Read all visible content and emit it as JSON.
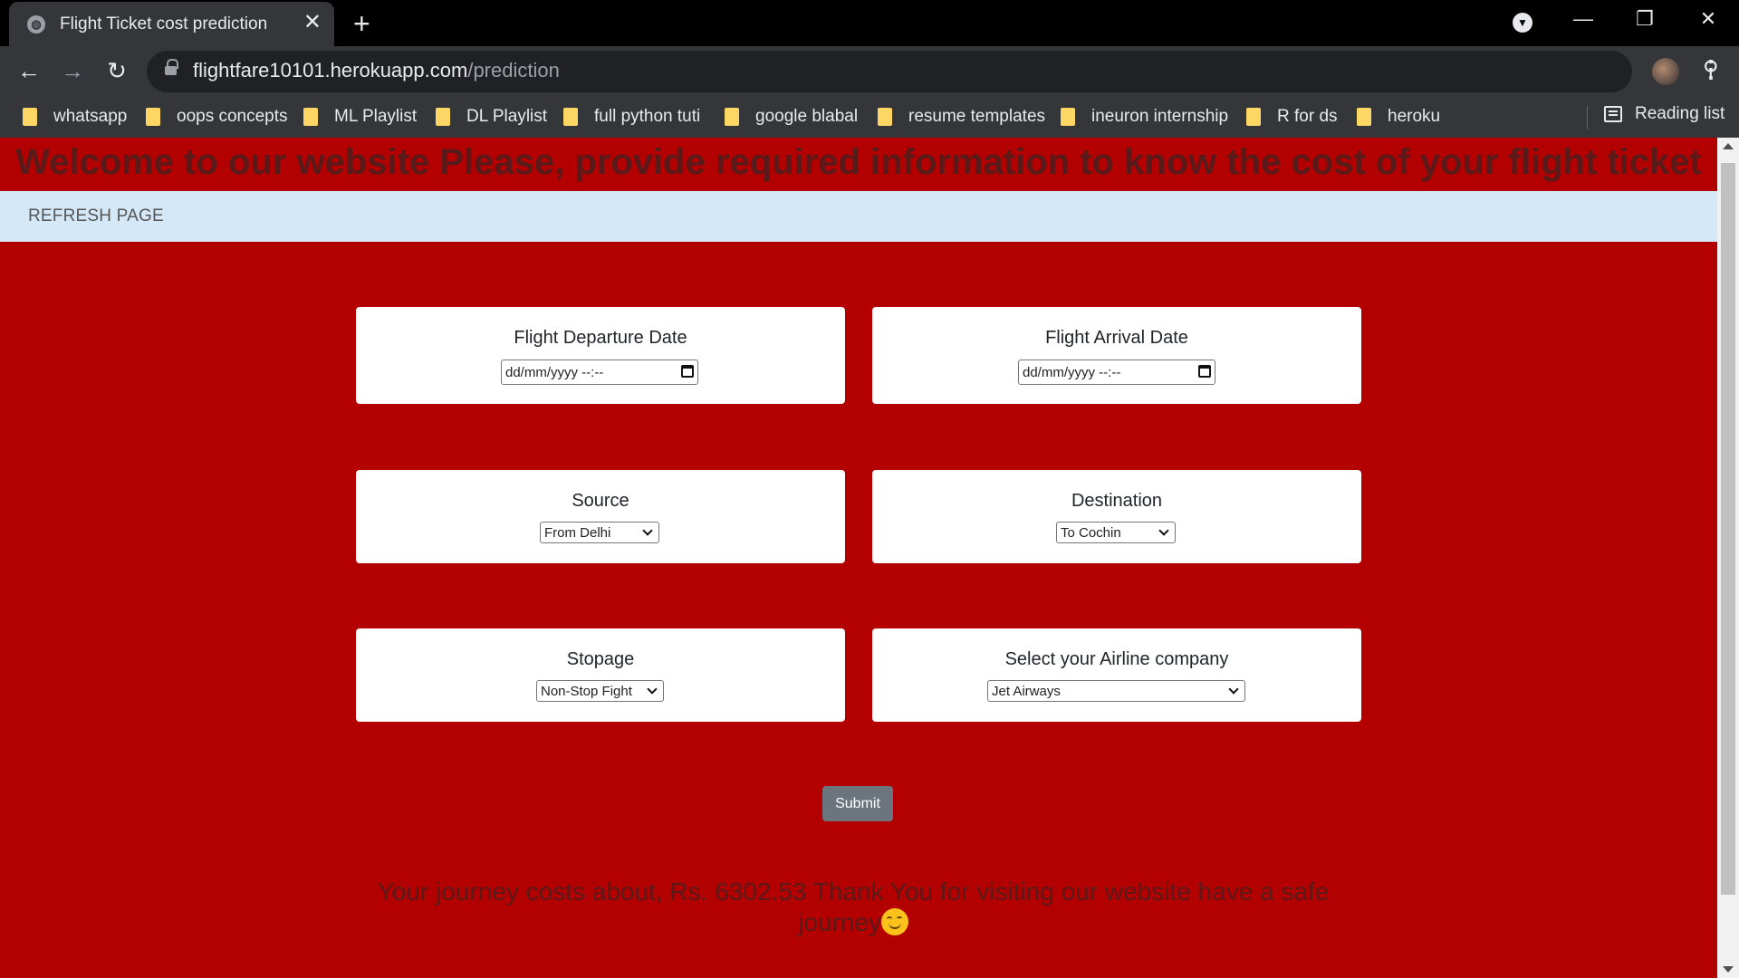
{
  "browser": {
    "tab_title": "Flight Ticket cost prediction",
    "url_host": "flightfare10101.herokuapp.com",
    "url_path": "/prediction",
    "bookmarks": [
      "whatsapp",
      "oops concepts",
      "ML Playlist",
      "DL Playlist",
      "full python tuti",
      "google blabal",
      "resume templates",
      "ineuron internship",
      "R for ds",
      "heroku"
    ],
    "reading_list": "Reading list"
  },
  "page": {
    "welcome": "Welcome to our website Please, provide required information to know the cost of your flight ticket",
    "refresh": "REFRESH PAGE",
    "departure": {
      "label": "Flight Departure Date",
      "placeholder": "dd/mm/yyyy --:--"
    },
    "arrival": {
      "label": "Flight Arrival Date",
      "placeholder": "dd/mm/yyyy --:--"
    },
    "source": {
      "label": "Source",
      "value": "From Delhi"
    },
    "destination": {
      "label": "Destination",
      "value": "To Cochin"
    },
    "stopage": {
      "label": "Stopage",
      "value": "Non-Stop Fight"
    },
    "airline": {
      "label": "Select your Airline company",
      "value": "Jet Airways"
    },
    "submit": "Submit",
    "result": "Your journey costs about, Rs. 6302.53 Thank You for visiting our website have a safe journey"
  },
  "colors": {
    "page_bg": "#b30000",
    "navbar_bg": "#d4e8f7",
    "heading": "#5a1a1a",
    "submit_bg": "#6c757d"
  }
}
